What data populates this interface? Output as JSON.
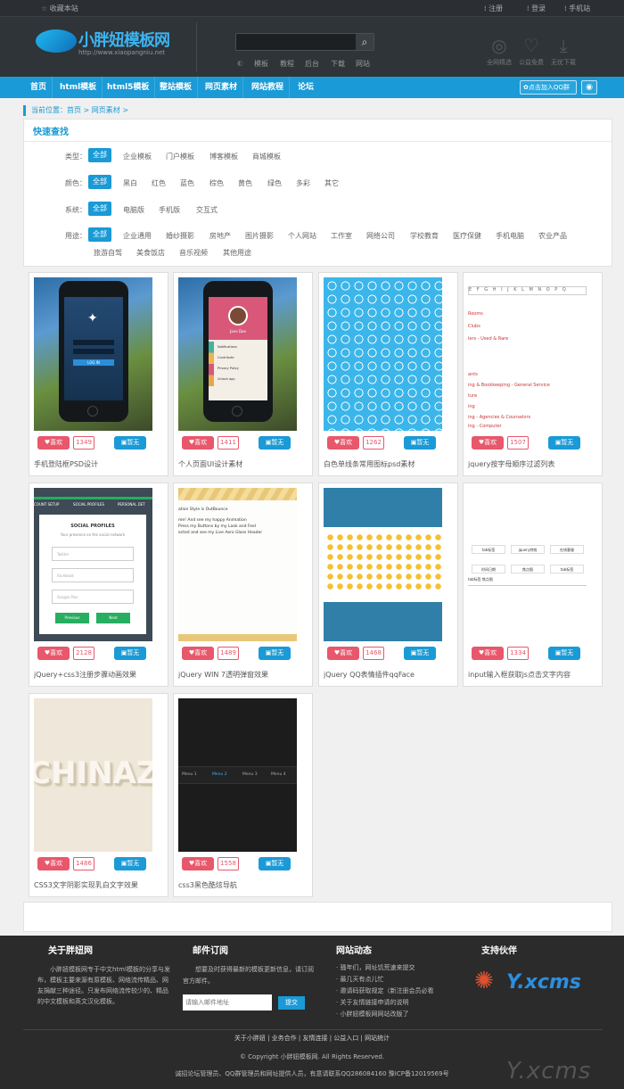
{
  "topbar": {
    "favorite": "收藏本站",
    "register": "注册",
    "login": "登录",
    "mobile": "手机站"
  },
  "logo": {
    "name": "小胖妞模板网",
    "url": "http://www.xiaopangniu.net"
  },
  "search": {
    "placeholder": "",
    "button_icon": "magnifier",
    "hot": [
      "模板",
      "教程",
      "后台",
      "下载",
      "网站"
    ]
  },
  "header_icons": [
    {
      "label": "全网精选",
      "icon": "broadcast-icon"
    },
    {
      "label": "公益免费",
      "icon": "heart-icon"
    },
    {
      "label": "无忧下载",
      "icon": "download-icon"
    }
  ],
  "nav": {
    "items": [
      "首页",
      "html模板",
      "html5模板",
      "整站模板",
      "网页素材",
      "网站教程",
      "论坛"
    ],
    "qq": "点击加入QQ群"
  },
  "breadcrumb": "当前位置：首页 > 网页素材 >",
  "filter": {
    "title": "快速查找",
    "rows": [
      {
        "label": "类型：",
        "options": [
          "全部",
          "企业模板",
          "门户模板",
          "博客模板",
          "商城模板"
        ]
      },
      {
        "label": "颜色：",
        "options": [
          "全部",
          "黑白",
          "红色",
          "蓝色",
          "棕色",
          "黄色",
          "绿色",
          "多彩",
          "其它"
        ]
      },
      {
        "label": "系统：",
        "options": [
          "全部",
          "电脑版",
          "手机版",
          "交互式"
        ]
      },
      {
        "label": "用途：",
        "options": [
          "全部",
          "企业通用",
          "婚纱摄影",
          "房地产",
          "图片摄影",
          "个人网站",
          "工作室",
          "网络公司",
          "学校教育",
          "医疗保健",
          "手机电脑",
          "农业产品",
          "旅游自驾",
          "美食饭店",
          "音乐视频",
          "其他用途"
        ]
      }
    ]
  },
  "cards": [
    {
      "title": "手机登陆框PSD设计",
      "count": "1349"
    },
    {
      "title": "个人页面UI设计素材",
      "count": "1411"
    },
    {
      "title": "白色单线条常用图标psd素材",
      "count": "1262"
    },
    {
      "title": "jquery按字母顺序过滤列表",
      "count": "1507"
    },
    {
      "title": "jQuery+css3注册步骤动画效果",
      "count": "2128"
    },
    {
      "title": "jQuery WIN 7透明弹窗效果",
      "count": "1489"
    },
    {
      "title": "jQuery QQ表情插件qqFace",
      "count": "1468"
    },
    {
      "title": "input输入框获取js点击文字内容",
      "count": "1334"
    },
    {
      "title": "CSS3文字阴影实现乳白文字效果",
      "count": "1486"
    },
    {
      "title": "css3黑色酷炫导航",
      "count": "1558"
    }
  ],
  "card_labels": {
    "like": "喜欢",
    "status": "暂无"
  },
  "previews": {
    "login_btn": "LOG IN",
    "profile_name": "Jane Doe",
    "profile_items": [
      "Notifications",
      "Contribute",
      "Privacy Policy",
      "Unlock app"
    ],
    "alpha_letters": [
      "E",
      "F",
      "G",
      "H",
      "I",
      "J",
      "K",
      "L",
      "M",
      "N",
      "O",
      "P",
      "Q"
    ],
    "alpha_lines": [
      "Rooms",
      "Clubs",
      "lers - Used & Rare",
      "",
      "ants",
      "ing & Bookkeeping - General Service",
      "ture",
      "ing",
      "ing - Agencies & Counselors",
      "ing - Computer"
    ],
    "steps": [
      "COUNT SETUP",
      "SOCIAL PROFILES",
      "PERSONAL DET"
    ],
    "social_title": "SOCIAL PROFILES",
    "social_sub": "Your presence on the social network",
    "social_fields": [
      "Twitter",
      "Facebook",
      "Google Plus"
    ],
    "social_prev": "Previous",
    "social_next": "Next",
    "win7_lines": [
      "ation Style is OutBounce",
      "me! And see my happy Animation",
      "Press my Buttons by my Look and Feel",
      "ected and see my Live Aero Glass Header"
    ],
    "input_row1": [
      "tab标签",
      "jquery特效",
      "在线客服"
    ],
    "input_row2": [
      "时间日期",
      "焦点图",
      "tab标签"
    ],
    "input_text": "tab标签 焦点图",
    "chinaz": "CHINAZ",
    "menu": [
      "Menu 1",
      "Menu 2",
      "Menu 3",
      "Menu 4"
    ]
  },
  "footer": {
    "about": {
      "title": "关于胖妞网",
      "text": "小胖妞模板网专于中文html模板的分享与发布，模板主要来源有原模板、网络流传精品、网友捐献三种途径。只发布网络流传较少的、精品的中文模板和英文汉化模板。"
    },
    "mail": {
      "title": "邮件订阅",
      "text": "想要及时获得最新的模板更新信息，请订阅官方邮件。",
      "placeholder": "请输入邮件地址",
      "button": "提交"
    },
    "news": {
      "title": "网站动态",
      "items": [
        "· 骚年们，网址饥荒速来提交",
        "· 最几天有点儿忙",
        "· 邀请码获取规定（新注册会员必看",
        "· 关于友情链接申请的说明",
        "· 小胖妞模板网网站改版了"
      ]
    },
    "partner": {
      "title": "支持伙伴",
      "logo": "Y.xcms"
    },
    "links": "关于小胖妞 | 业务合作 | 友情连接 | 公益入口 | 网站统计",
    "copyright": "© Copyright 小胖妞模板网. All Rights Reserved.",
    "icp": "诚招论坛管理员、QQ群管理员和网址提供人员，有意请联系QQ286084160 豫ICP备12019569号",
    "watermark": "Y.xcms"
  }
}
